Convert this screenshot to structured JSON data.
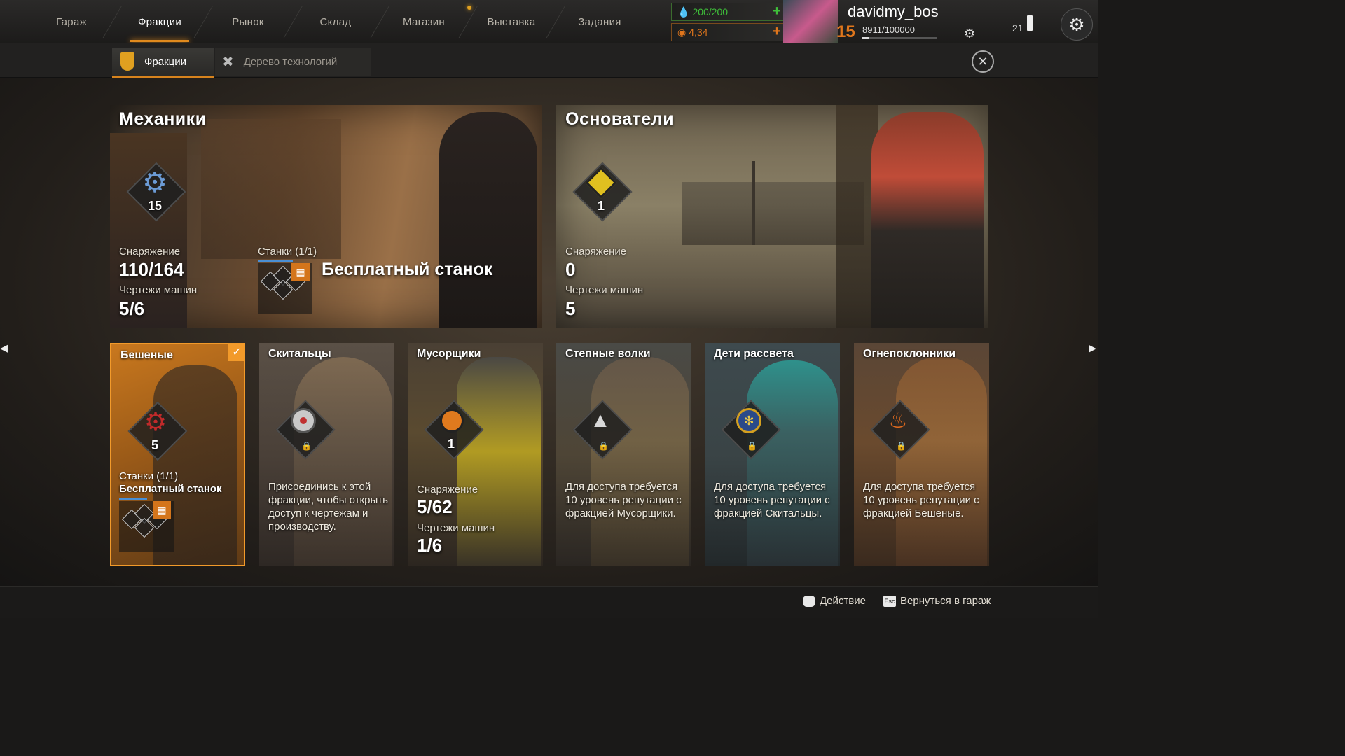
{
  "nav": {
    "tabs": [
      "Гараж",
      "Фракции",
      "Рынок",
      "Склад",
      "Магазин",
      "Выставка",
      "Задания"
    ],
    "active_tab": "Фракции"
  },
  "resources": {
    "fuel": "200/200",
    "coins": "4,34"
  },
  "user": {
    "name": "davidmy_bos",
    "level": "15",
    "xp": "8911/100000",
    "xp_fraction": 0.089,
    "notifications": "21"
  },
  "subnav": {
    "factions_label": "Фракции",
    "techtree_label": "Дерево технологий"
  },
  "big_factions": [
    {
      "name": "Механики",
      "level": "15",
      "gear_label": "Снаряжение",
      "gear_value": "110/164",
      "blueprints_label": "Чертежи машин",
      "blueprints_value": "5/6",
      "stations_label": "Станки (1/1)",
      "free_station": "Бесплатный станок"
    },
    {
      "name": "Основатели",
      "level": "1",
      "gear_label": "Снаряжение",
      "gear_value": "0",
      "blueprints_label": "Чертежи машин",
      "blueprints_value": "5"
    }
  ],
  "small_factions": [
    {
      "name": "Бешеные",
      "level": "5",
      "stations_label": "Станки (1/1)",
      "free_station": "Бесплатный станок",
      "selected": true
    },
    {
      "name": "Скитальцы",
      "description": "Присоединись к этой фракции, чтобы открыть доступ к чертежам и производству."
    },
    {
      "name": "Мусорщики",
      "level": "1",
      "gear_label": "Снаряжение",
      "gear_value": "5/62",
      "blueprints_label": "Чертежи машин",
      "blueprints_value": "1/6"
    },
    {
      "name": "Степные волки",
      "description": "Для доступа требуется 10 уровень репутации с фракцией Мусорщики."
    },
    {
      "name": "Дети рассвета",
      "description": "Для доступа требуется 10 уровень репутации с фракцией Скитальцы."
    },
    {
      "name": "Огнепоклонники",
      "description": "Для доступа требуется 10 уровень репутации с фракцией Бешеные."
    }
  ],
  "footer": {
    "action_key": "",
    "action_label": "Действие",
    "back_key": "Esc",
    "back_label": "Вернуться в гараж"
  },
  "colors": {
    "accent": "#e08a1e",
    "fuel_green": "#3fbf3a",
    "coin_orange": "#e0761c"
  }
}
